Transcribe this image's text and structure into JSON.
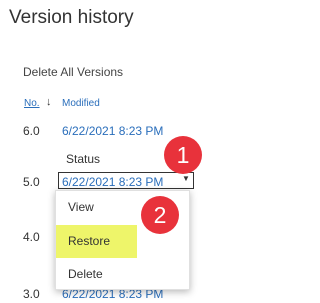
{
  "page_title": "Version history",
  "delete_all": "Delete All Versions",
  "columns": {
    "no": "No.",
    "sort_arrow": "↓",
    "modified": "Modified"
  },
  "versions": [
    {
      "number": "6.0",
      "modified": "6/22/2021 8:23 PM"
    },
    {
      "number": "5.0",
      "modified": "6/22/2021 8:23 PM"
    },
    {
      "number": "4.0",
      "modified": ""
    },
    {
      "number": "3.0",
      "modified": "6/22/2021 8:23 PM"
    }
  ],
  "status_label": "Status",
  "context_menu": {
    "items": [
      "View",
      "Restore",
      "Delete"
    ],
    "highlighted": "Restore"
  },
  "callouts": {
    "step1": "1",
    "step2": "2"
  },
  "colors": {
    "link": "#2a6ebb",
    "highlight": "#eef56a",
    "callout": "#e8323b"
  }
}
